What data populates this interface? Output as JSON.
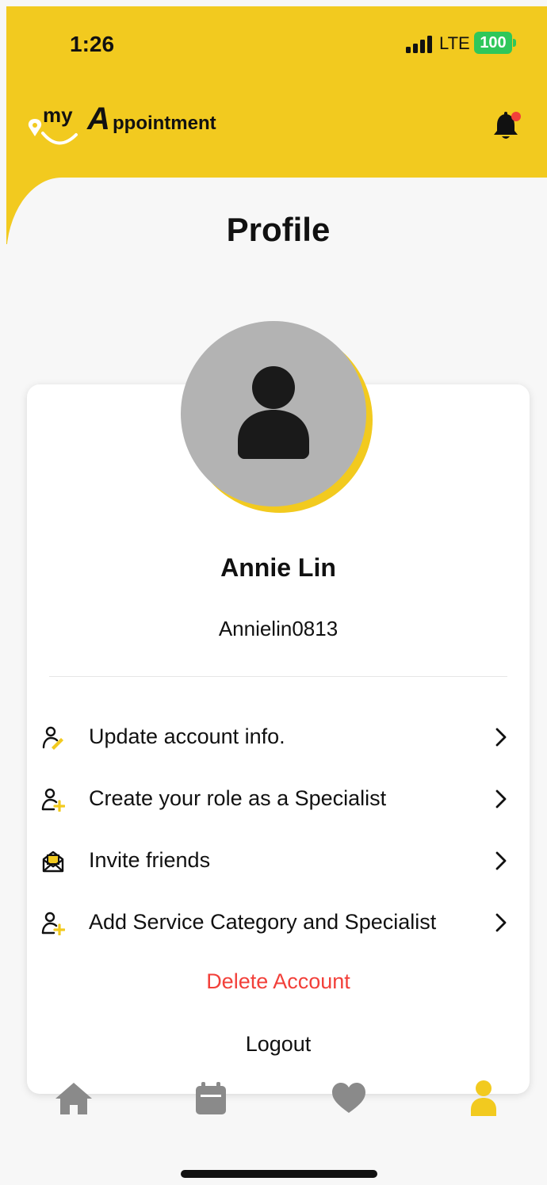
{
  "status_bar": {
    "time": "1:26",
    "network": "LTE",
    "battery": "100"
  },
  "header": {
    "logo_prefix": "my",
    "logo_letter": "A",
    "logo_suffix": "ppointment",
    "logo_icon": "location-pin-smile-icon",
    "notification_icon": "bell-icon",
    "has_unread": true
  },
  "page": {
    "title": "Profile"
  },
  "profile": {
    "name": "Annie Lin",
    "username": "Annielin0813",
    "avatar_icon": "person-icon"
  },
  "menu": [
    {
      "label": "Update account info.",
      "icon": "user-edit-icon"
    },
    {
      "label": "Create your role as a Specialist",
      "icon": "user-add-icon"
    },
    {
      "label": "Invite friends",
      "icon": "mail-invite-icon"
    },
    {
      "label": "Add Service Category and Specialist",
      "icon": "user-add-icon"
    }
  ],
  "actions": {
    "delete_label": "Delete Account",
    "logout_label": "Logout"
  },
  "tabs": [
    {
      "icon": "home-icon",
      "active": false
    },
    {
      "icon": "calendar-icon",
      "active": false
    },
    {
      "icon": "heart-icon",
      "active": false
    },
    {
      "icon": "profile-icon",
      "active": true
    }
  ],
  "colors": {
    "brand_yellow": "#f2ca1f",
    "danger": "#f2403a",
    "inactive_tab": "#8a8a8a",
    "avatar_bg": "#b3b3b3"
  }
}
